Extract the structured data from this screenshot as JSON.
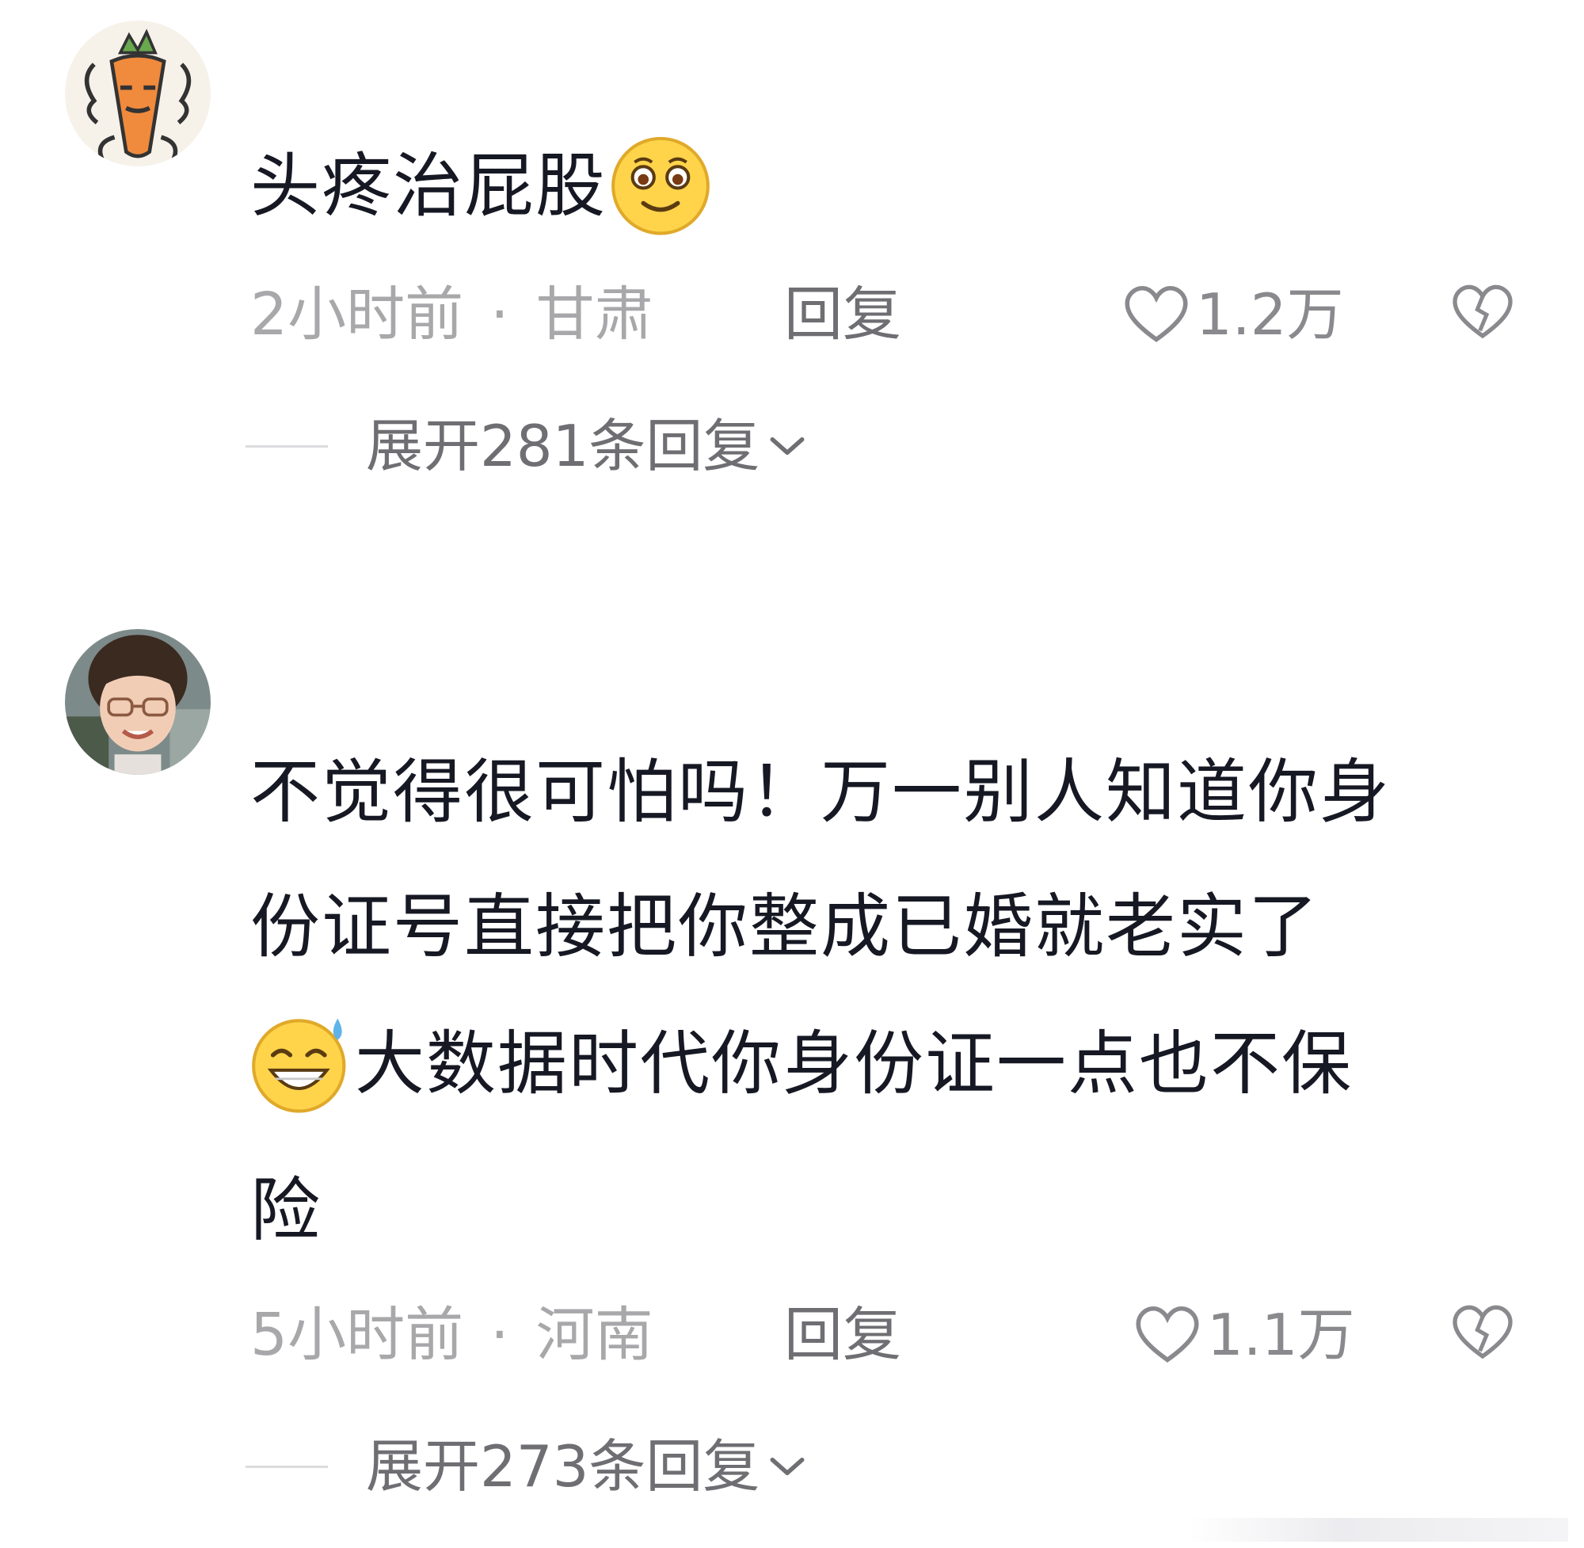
{
  "comments": [
    {
      "avatar_icon": "carrot-character-avatar",
      "lines": [
        "头疼治屁股"
      ],
      "emoji_icon": "smiling-emoji",
      "time": "2小时前",
      "separator": "·",
      "location": "甘肃",
      "reply_label": "回复",
      "likes": "1.2万",
      "expand_label": "展开281条回复"
    },
    {
      "avatar_icon": "girl-with-glasses-avatar",
      "lines": [
        "不觉得很可怕吗！万一别人知道你身",
        "份证号直接把你整成已婚就老实了",
        "大数据时代你身份证一点也不保",
        "险"
      ],
      "emoji_icon": "grinning-sweat-emoji",
      "time": "5小时前",
      "separator": "·",
      "location": "河南",
      "reply_label": "回复",
      "likes": "1.1万",
      "expand_label": "展开273条回复"
    }
  ],
  "colors": {
    "text": "#161823",
    "meta": "#a8a8ab",
    "action": "#6e6e73",
    "emoji_face": "#ffd44a"
  }
}
